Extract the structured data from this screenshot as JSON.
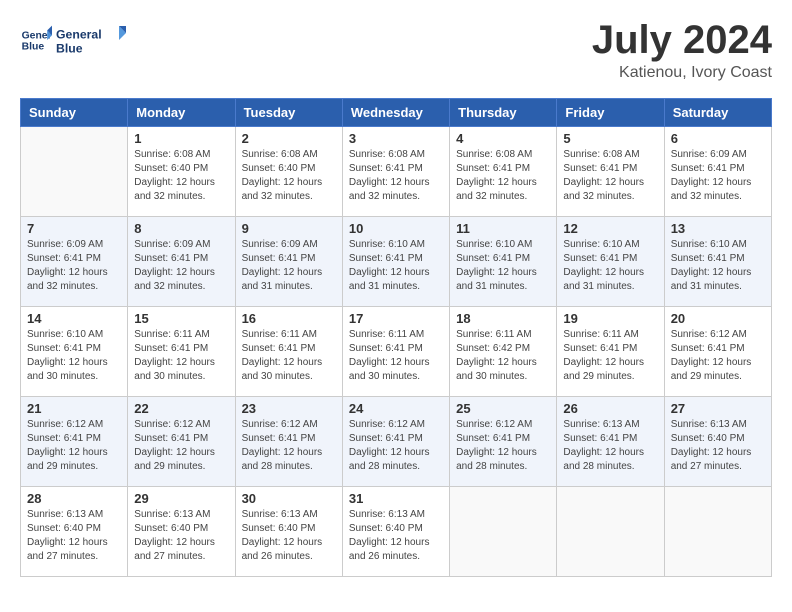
{
  "header": {
    "logo_line1": "General",
    "logo_line2": "Blue",
    "month": "July 2024",
    "location": "Katienou, Ivory Coast"
  },
  "days_of_week": [
    "Sunday",
    "Monday",
    "Tuesday",
    "Wednesday",
    "Thursday",
    "Friday",
    "Saturday"
  ],
  "weeks": [
    [
      {
        "day": "",
        "sunrise": "",
        "sunset": "",
        "daylight": ""
      },
      {
        "day": "1",
        "sunrise": "Sunrise: 6:08 AM",
        "sunset": "Sunset: 6:40 PM",
        "daylight": "Daylight: 12 hours and 32 minutes."
      },
      {
        "day": "2",
        "sunrise": "Sunrise: 6:08 AM",
        "sunset": "Sunset: 6:40 PM",
        "daylight": "Daylight: 12 hours and 32 minutes."
      },
      {
        "day": "3",
        "sunrise": "Sunrise: 6:08 AM",
        "sunset": "Sunset: 6:41 PM",
        "daylight": "Daylight: 12 hours and 32 minutes."
      },
      {
        "day": "4",
        "sunrise": "Sunrise: 6:08 AM",
        "sunset": "Sunset: 6:41 PM",
        "daylight": "Daylight: 12 hours and 32 minutes."
      },
      {
        "day": "5",
        "sunrise": "Sunrise: 6:08 AM",
        "sunset": "Sunset: 6:41 PM",
        "daylight": "Daylight: 12 hours and 32 minutes."
      },
      {
        "day": "6",
        "sunrise": "Sunrise: 6:09 AM",
        "sunset": "Sunset: 6:41 PM",
        "daylight": "Daylight: 12 hours and 32 minutes."
      }
    ],
    [
      {
        "day": "7",
        "sunrise": "Sunrise: 6:09 AM",
        "sunset": "Sunset: 6:41 PM",
        "daylight": "Daylight: 12 hours and 32 minutes."
      },
      {
        "day": "8",
        "sunrise": "Sunrise: 6:09 AM",
        "sunset": "Sunset: 6:41 PM",
        "daylight": "Daylight: 12 hours and 32 minutes."
      },
      {
        "day": "9",
        "sunrise": "Sunrise: 6:09 AM",
        "sunset": "Sunset: 6:41 PM",
        "daylight": "Daylight: 12 hours and 31 minutes."
      },
      {
        "day": "10",
        "sunrise": "Sunrise: 6:10 AM",
        "sunset": "Sunset: 6:41 PM",
        "daylight": "Daylight: 12 hours and 31 minutes."
      },
      {
        "day": "11",
        "sunrise": "Sunrise: 6:10 AM",
        "sunset": "Sunset: 6:41 PM",
        "daylight": "Daylight: 12 hours and 31 minutes."
      },
      {
        "day": "12",
        "sunrise": "Sunrise: 6:10 AM",
        "sunset": "Sunset: 6:41 PM",
        "daylight": "Daylight: 12 hours and 31 minutes."
      },
      {
        "day": "13",
        "sunrise": "Sunrise: 6:10 AM",
        "sunset": "Sunset: 6:41 PM",
        "daylight": "Daylight: 12 hours and 31 minutes."
      }
    ],
    [
      {
        "day": "14",
        "sunrise": "Sunrise: 6:10 AM",
        "sunset": "Sunset: 6:41 PM",
        "daylight": "Daylight: 12 hours and 30 minutes."
      },
      {
        "day": "15",
        "sunrise": "Sunrise: 6:11 AM",
        "sunset": "Sunset: 6:41 PM",
        "daylight": "Daylight: 12 hours and 30 minutes."
      },
      {
        "day": "16",
        "sunrise": "Sunrise: 6:11 AM",
        "sunset": "Sunset: 6:41 PM",
        "daylight": "Daylight: 12 hours and 30 minutes."
      },
      {
        "day": "17",
        "sunrise": "Sunrise: 6:11 AM",
        "sunset": "Sunset: 6:41 PM",
        "daylight": "Daylight: 12 hours and 30 minutes."
      },
      {
        "day": "18",
        "sunrise": "Sunrise: 6:11 AM",
        "sunset": "Sunset: 6:42 PM",
        "daylight": "Daylight: 12 hours and 30 minutes."
      },
      {
        "day": "19",
        "sunrise": "Sunrise: 6:11 AM",
        "sunset": "Sunset: 6:41 PM",
        "daylight": "Daylight: 12 hours and 29 minutes."
      },
      {
        "day": "20",
        "sunrise": "Sunrise: 6:12 AM",
        "sunset": "Sunset: 6:41 PM",
        "daylight": "Daylight: 12 hours and 29 minutes."
      }
    ],
    [
      {
        "day": "21",
        "sunrise": "Sunrise: 6:12 AM",
        "sunset": "Sunset: 6:41 PM",
        "daylight": "Daylight: 12 hours and 29 minutes."
      },
      {
        "day": "22",
        "sunrise": "Sunrise: 6:12 AM",
        "sunset": "Sunset: 6:41 PM",
        "daylight": "Daylight: 12 hours and 29 minutes."
      },
      {
        "day": "23",
        "sunrise": "Sunrise: 6:12 AM",
        "sunset": "Sunset: 6:41 PM",
        "daylight": "Daylight: 12 hours and 28 minutes."
      },
      {
        "day": "24",
        "sunrise": "Sunrise: 6:12 AM",
        "sunset": "Sunset: 6:41 PM",
        "daylight": "Daylight: 12 hours and 28 minutes."
      },
      {
        "day": "25",
        "sunrise": "Sunrise: 6:12 AM",
        "sunset": "Sunset: 6:41 PM",
        "daylight": "Daylight: 12 hours and 28 minutes."
      },
      {
        "day": "26",
        "sunrise": "Sunrise: 6:13 AM",
        "sunset": "Sunset: 6:41 PM",
        "daylight": "Daylight: 12 hours and 28 minutes."
      },
      {
        "day": "27",
        "sunrise": "Sunrise: 6:13 AM",
        "sunset": "Sunset: 6:40 PM",
        "daylight": "Daylight: 12 hours and 27 minutes."
      }
    ],
    [
      {
        "day": "28",
        "sunrise": "Sunrise: 6:13 AM",
        "sunset": "Sunset: 6:40 PM",
        "daylight": "Daylight: 12 hours and 27 minutes."
      },
      {
        "day": "29",
        "sunrise": "Sunrise: 6:13 AM",
        "sunset": "Sunset: 6:40 PM",
        "daylight": "Daylight: 12 hours and 27 minutes."
      },
      {
        "day": "30",
        "sunrise": "Sunrise: 6:13 AM",
        "sunset": "Sunset: 6:40 PM",
        "daylight": "Daylight: 12 hours and 26 minutes."
      },
      {
        "day": "31",
        "sunrise": "Sunrise: 6:13 AM",
        "sunset": "Sunset: 6:40 PM",
        "daylight": "Daylight: 12 hours and 26 minutes."
      },
      {
        "day": "",
        "sunrise": "",
        "sunset": "",
        "daylight": ""
      },
      {
        "day": "",
        "sunrise": "",
        "sunset": "",
        "daylight": ""
      },
      {
        "day": "",
        "sunrise": "",
        "sunset": "",
        "daylight": ""
      }
    ]
  ]
}
